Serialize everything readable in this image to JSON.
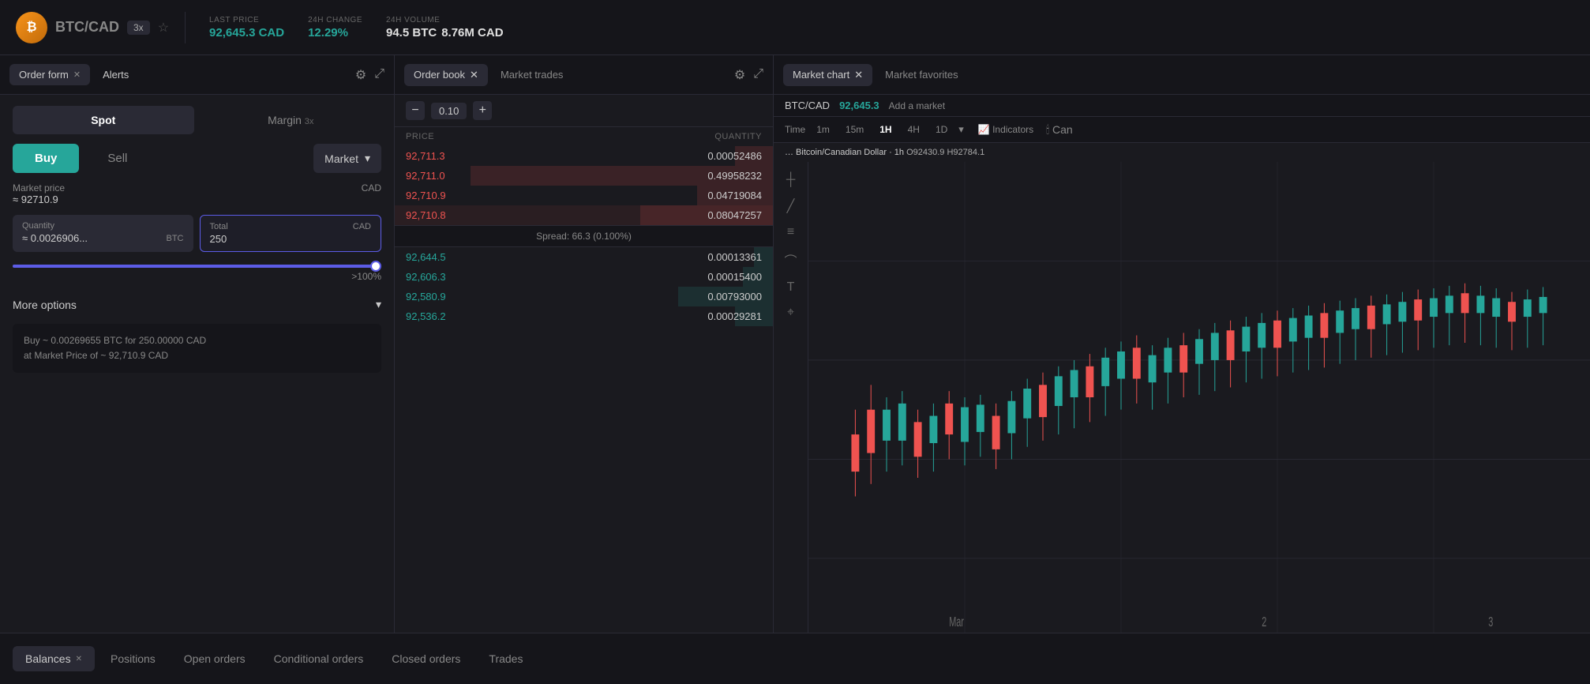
{
  "topbar": {
    "logo_letter": "₿",
    "pair": "BTC",
    "pair_quote": "/CAD",
    "leverage": "3x",
    "last_price_label": "LAST PRICE",
    "last_price_value": "92,645.3 CAD",
    "change_label": "24H CHANGE",
    "change_value": "12.29%",
    "volume_label": "24H VOLUME",
    "volume_btc": "94.5 BTC",
    "volume_cad": "8.76M CAD"
  },
  "left_panel": {
    "tab1": "Order form",
    "tab2": "Alerts",
    "spot_label": "Spot",
    "margin_label": "Margin",
    "margin_leverage": "3x",
    "buy_label": "Buy",
    "sell_label": "Sell",
    "order_type": "Market",
    "market_price_label": "Market price",
    "market_price_approx": "≈ 92710.9",
    "market_price_cad": "CAD",
    "qty_label": "Quantity",
    "qty_value": "≈ 0.0026906...",
    "qty_currency": "BTC",
    "total_label": "Total",
    "total_value": "250",
    "total_currency": "CAD",
    "slider_pct": ">100%",
    "more_options": "More options",
    "summary_line1": "Buy ~ 0.00269655 BTC for 250.00000 CAD",
    "summary_line2": "at Market Price of ~ 92,710.9 CAD"
  },
  "middle_panel": {
    "tab1": "Order book",
    "tab2": "Market trades",
    "spread_value": "0.10",
    "col_price": "PRICE",
    "col_qty": "QUANTITY",
    "sell_orders": [
      {
        "price": "92,711.3",
        "qty": "0.00052486",
        "bar_pct": 10
      },
      {
        "price": "92,711.0",
        "qty": "0.49958232",
        "bar_pct": 80
      },
      {
        "price": "92,710.9",
        "qty": "0.04719084",
        "bar_pct": 20
      },
      {
        "price": "92,710.8",
        "qty": "0.08047257",
        "bar_pct": 35
      }
    ],
    "spread_text": "Spread: 66.3 (0.100%)",
    "buy_orders": [
      {
        "price": "92,644.5",
        "qty": "0.00013361",
        "bar_pct": 5
      },
      {
        "price": "92,606.3",
        "qty": "0.00015400",
        "bar_pct": 8
      },
      {
        "price": "92,580.9",
        "qty": "0.00793000",
        "bar_pct": 25
      },
      {
        "price": "92,536.2",
        "qty": "0.00029281",
        "bar_pct": 10
      }
    ]
  },
  "right_panel": {
    "tab1": "Market chart",
    "tab2": "Market favorites",
    "market_pair": "BTC/CAD",
    "market_price": "92,645.3",
    "add_market": "Add a market",
    "time_label": "Time",
    "time_options": [
      "1m",
      "15m",
      "1H",
      "4H",
      "1D"
    ],
    "time_active": "1H",
    "chart_info": "… Bitcoin/Canadian Dollar · 1h",
    "chart_o": "O92430.9",
    "chart_h": "H92784.1",
    "label_mar": "Mar",
    "label_2": "2",
    "label_3": "3"
  },
  "bottom_bar": {
    "tabs": [
      "Balances",
      "Positions",
      "Open orders",
      "Conditional orders",
      "Closed orders",
      "Trades"
    ],
    "active_tab": "Balances"
  },
  "icons": {
    "gear": "⚙",
    "expand": "⤢",
    "chevron_down": "▾",
    "star": "☆",
    "close": "✕",
    "minus": "−",
    "plus": "+",
    "indicators": "📈",
    "candle": "🕯"
  }
}
